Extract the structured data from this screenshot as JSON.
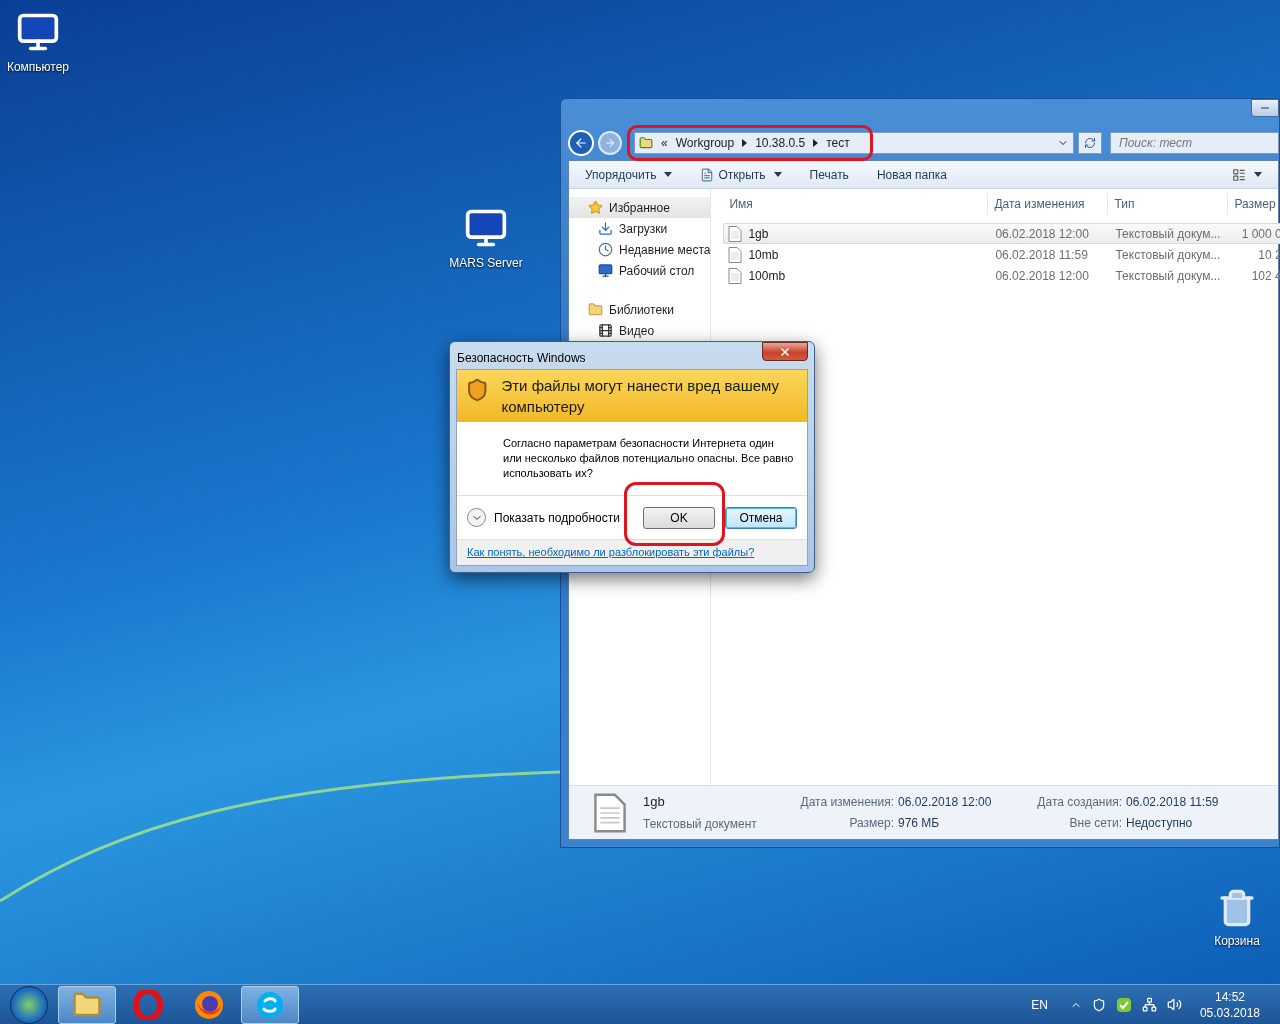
{
  "desktop_icons": [
    {
      "kind": "computer",
      "label": "Компьютер"
    },
    {
      "kind": "server",
      "label": "MARS Server"
    },
    {
      "kind": "recycle_bin",
      "label": "Корзина"
    }
  ],
  "explorer": {
    "address": {
      "overflow": "«",
      "parts": [
        "Workgroup",
        "10.38.0.5",
        "тест"
      ]
    },
    "search": {
      "placeholder": "Поиск: тест"
    },
    "toolbar": [
      {
        "label": "Упорядочить",
        "dropdown": true,
        "kind": "plain"
      },
      {
        "label": "Открыть",
        "dropdown": true,
        "kind": "open"
      },
      {
        "label": "Печать",
        "dropdown": false,
        "kind": "plain"
      },
      {
        "label": "Новая папка",
        "dropdown": false,
        "kind": "plain"
      }
    ],
    "sidebar": [
      {
        "label": "Избранное",
        "kind": "favorites",
        "selected": true,
        "children": [
          {
            "label": "Загрузки",
            "kind": "downloads"
          },
          {
            "label": "Недавние места",
            "kind": "recent"
          },
          {
            "label": "Рабочий стол",
            "kind": "desktop"
          }
        ]
      },
      {
        "label": "Библиотеки",
        "kind": "libraries",
        "selected": false,
        "children": [
          {
            "label": "Видео",
            "kind": "video"
          }
        ]
      }
    ],
    "columns": [
      "Имя",
      "Дата изменения",
      "Тип",
      "Размер"
    ],
    "rows": [
      {
        "name": "1gb",
        "modified": "06.02.2018 12:00",
        "type": "Текстовый докум...",
        "size": "1 000 0",
        "selected": true
      },
      {
        "name": "10mb",
        "modified": "06.02.2018 11:59",
        "type": "Текстовый докум...",
        "size": "10 2",
        "selected": false
      },
      {
        "name": "100mb",
        "modified": "06.02.2018 12:00",
        "type": "Текстовый докум...",
        "size": "102 4",
        "selected": false
      }
    ],
    "details": {
      "name": "1gb",
      "type": "Текстовый документ",
      "fields": [
        {
          "label": "Дата изменения:",
          "value": "06.02.2018 12:00"
        },
        {
          "label": "Дата создания:",
          "value": "06.02.2018 11:59"
        },
        {
          "label": "Размер:",
          "value": "976 МБ"
        },
        {
          "label": "Вне сети:",
          "value": "Недоступно"
        }
      ]
    }
  },
  "dialog": {
    "title": "Безопасность Windows",
    "heading": "Эти файлы могут нанести вред вашему компьютеру",
    "body": "Согласно параметрам безопасности Интернета один или несколько файлов потенциально опасны. Все равно использовать их?",
    "details_toggle": {
      "label": "Показать подробности",
      "expanded": false
    },
    "buttons": [
      {
        "label": "OK",
        "default": false
      },
      {
        "label": "Отмена",
        "default": true
      }
    ],
    "link": "Как понять, необходимо ли разблокировать эти файлы?"
  },
  "taskbar": {
    "apps": [
      {
        "kind": "explorer",
        "selected": true
      },
      {
        "kind": "opera",
        "selected": false
      },
      {
        "kind": "firefox",
        "selected": false
      },
      {
        "kind": "skype",
        "selected": true
      }
    ],
    "language": "EN",
    "time": "14:52",
    "date": "05.03.2018"
  }
}
